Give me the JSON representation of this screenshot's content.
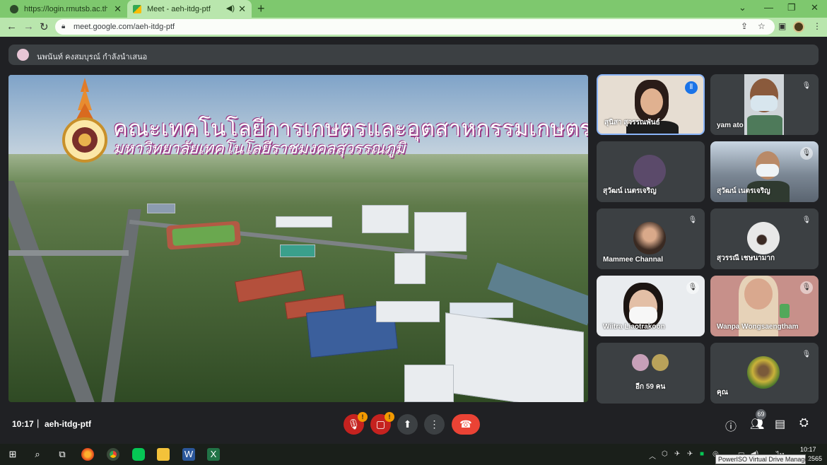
{
  "browser": {
    "tabs": [
      {
        "title": "https://login.rmutsb.ac.th/login.p"
      },
      {
        "title": "Meet - aeh-itdg-ptf"
      }
    ],
    "url": "meet.google.com/aeh-itdg-ptf"
  },
  "presenter": {
    "text": "นพนันท์ คงสมบุรณ์ กำลังนำเสนอ"
  },
  "presentation": {
    "title_line1": "คณะเทคโนโลยีการเกษตรและอุตสาหกรรมเกษตร",
    "title_line2": "มหาวิทยาลัยเทคโนโลยีราชมงคลสุวรรณภูมิ"
  },
  "participants": [
    {
      "name": "สุนิสา สุวรรณพันธ์",
      "speaking": true
    },
    {
      "name": "yam ato",
      "muted": true
    },
    {
      "name": "สุวัฒน์ เนตรเจริญ"
    },
    {
      "name": "สุวัฒน์ เนตรเจริญ",
      "muted": true
    },
    {
      "name": "Mammee Channal",
      "muted": true
    },
    {
      "name": "สุวรรณี เชษนามาก",
      "muted": true
    },
    {
      "name": "Wiitra Liaotrakoon",
      "muted": true
    },
    {
      "name": "Wanpa Wongsaengtham",
      "muted": true
    },
    {
      "name": "อีก 59 คน"
    },
    {
      "name": "คุณ",
      "muted": true
    }
  ],
  "meeting": {
    "time": "10:17",
    "code": "aeh-itdg-ptf",
    "people_count": "69"
  },
  "alerts": {
    "mic": "!",
    "cam": "!"
  },
  "taskbar": {
    "time": "10:17",
    "year": "2565",
    "tooltip": "PowerISO Virtual Drive Manager"
  },
  "colors": {
    "chrome": "#7ec86e",
    "meet_bg": "#202124",
    "end_call": "#ea4335",
    "speaking": "#8ab4f8"
  }
}
